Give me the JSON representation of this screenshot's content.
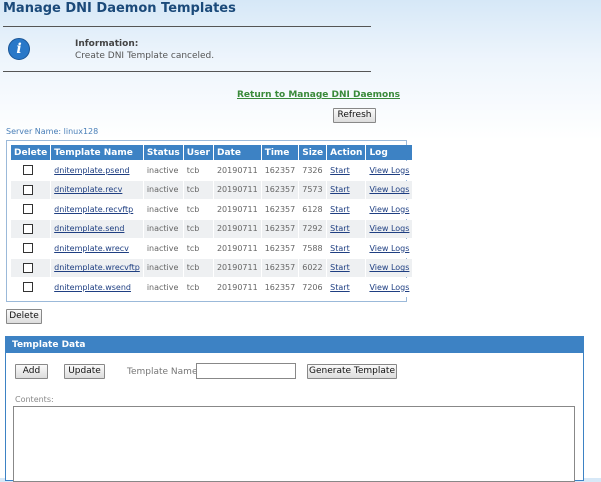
{
  "page": {
    "title": "Manage DNI Daemon Templates"
  },
  "info": {
    "heading": "Information:",
    "message": "Create DNI Template canceled.",
    "icon": "info-icon"
  },
  "links": {
    "return": "Return to Manage DNI Daemons"
  },
  "buttons": {
    "refresh": "Refresh",
    "delete": "Delete",
    "add": "Add",
    "update": "Update",
    "generate": "Generate Template"
  },
  "server": {
    "label": "Server Name:",
    "name": "linux128"
  },
  "table": {
    "headers": [
      "Delete",
      "Template Name",
      "Status",
      "User",
      "Date",
      "Time",
      "Size",
      "Action",
      "Log"
    ],
    "rows": [
      {
        "name": "dnitemplate.psend",
        "status": "inactive",
        "user": "tcb",
        "date": "20190711",
        "time": "162357",
        "size": "7326",
        "action": "Start",
        "log": "View Logs"
      },
      {
        "name": "dnitemplate.recv",
        "status": "inactive",
        "user": "tcb",
        "date": "20190711",
        "time": "162357",
        "size": "7573",
        "action": "Start",
        "log": "View Logs"
      },
      {
        "name": "dnitemplate.recvftp",
        "status": "inactive",
        "user": "tcb",
        "date": "20190711",
        "time": "162357",
        "size": "6128",
        "action": "Start",
        "log": "View Logs"
      },
      {
        "name": "dnitemplate.send",
        "status": "inactive",
        "user": "tcb",
        "date": "20190711",
        "time": "162357",
        "size": "7292",
        "action": "Start",
        "log": "View Logs"
      },
      {
        "name": "dnitemplate.wrecv",
        "status": "inactive",
        "user": "tcb",
        "date": "20190711",
        "time": "162357",
        "size": "7588",
        "action": "Start",
        "log": "View Logs"
      },
      {
        "name": "dnitemplate.wrecvftp",
        "status": "inactive",
        "user": "tcb",
        "date": "20190711",
        "time": "162357",
        "size": "6022",
        "action": "Start",
        "log": "View Logs"
      },
      {
        "name": "dnitemplate.wsend",
        "status": "inactive",
        "user": "tcb",
        "date": "20190711",
        "time": "162357",
        "size": "7206",
        "action": "Start",
        "log": "View Logs"
      }
    ]
  },
  "template_panel": {
    "title": "Template Data",
    "name_label": "Template Name:",
    "name_value": "",
    "contents_label": "Contents:",
    "contents_value": ""
  }
}
